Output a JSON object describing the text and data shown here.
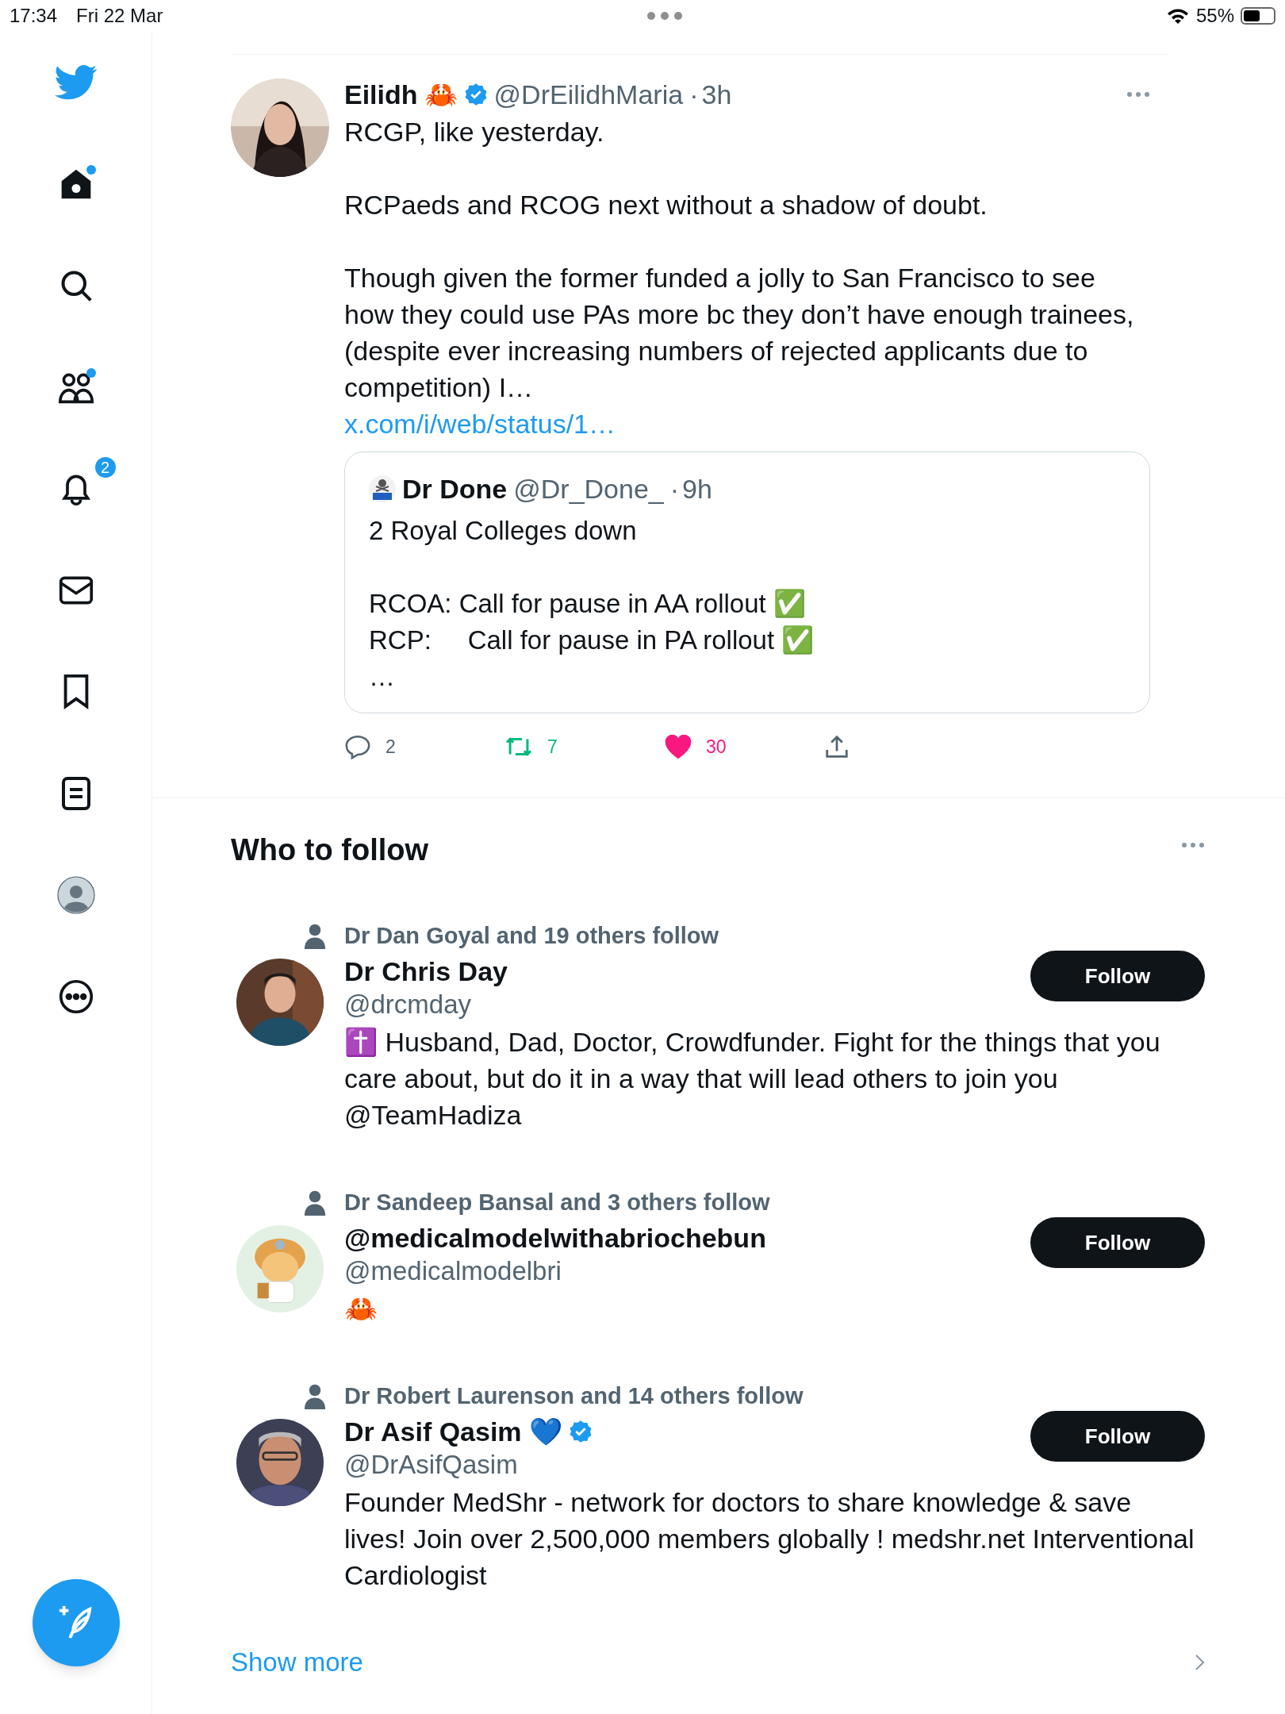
{
  "status_bar": {
    "time": "17:34",
    "date": "Fri 22 Mar",
    "battery": "55%"
  },
  "sidebar": {
    "items": [
      {
        "kind": "logo",
        "dot": false
      },
      {
        "kind": "home",
        "dot": true
      },
      {
        "kind": "search",
        "dot": false
      },
      {
        "kind": "communities",
        "dot": true
      },
      {
        "kind": "notifications",
        "dot": false,
        "badge": "2"
      },
      {
        "kind": "messages",
        "dot": false
      },
      {
        "kind": "bookmarks",
        "dot": false
      },
      {
        "kind": "lists",
        "dot": false
      },
      {
        "kind": "profile",
        "dot": false
      },
      {
        "kind": "more",
        "dot": false
      }
    ]
  },
  "tweet": {
    "author": "Eilidh",
    "author_emoji": "🦀",
    "verified": true,
    "handle": "@DrEilidhMaria",
    "separator": "·",
    "time": "3h",
    "paragraphs": [
      "RCGP, like yesterday.",
      "RCPaeds and RCOG next without a shadow of doubt.",
      "Though given the former funded a jolly to San Francisco to see how they could use PAs more bc they don’t have enough trainees, (despite ever increasing numbers of rejected applicants due to competition) I…"
    ],
    "link": "x.com/i/web/status/1…",
    "quote": {
      "author": "Dr Done",
      "handle": "@Dr_Done_",
      "separator": "·",
      "time": "9h",
      "paragraphs": [
        "2 Royal Colleges down",
        "RCOA: Call for pause in AA rollout ✅\nRCP:     Call for pause in PA rollout ✅\n…"
      ]
    },
    "actions": [
      {
        "kind": "reply",
        "count": "2",
        "on": false
      },
      {
        "kind": "retweet",
        "count": "7",
        "on": true
      },
      {
        "kind": "like",
        "count": "30",
        "on": true
      },
      {
        "kind": "share",
        "on": false
      }
    ]
  },
  "who_to_follow": {
    "title": "Who to follow",
    "suggestions": [
      {
        "context": "Dr Dan Goyal and 19 others follow",
        "name": "Dr Chris Day",
        "verified": false,
        "handle": "@drcmday",
        "bio": "✝️ Husband, Dad, Doctor, Crowdfunder. Fight for the things that you care about, but do it in a way that will lead others to join you @TeamHadiza",
        "button": "Follow"
      },
      {
        "context": "Dr Sandeep Bansal and 3 others follow",
        "name": "@medicalmodelwithabriochebun",
        "verified": false,
        "handle": "@medicalmodelbri",
        "bio": "🦀",
        "button": "Follow"
      },
      {
        "context": "Dr Robert Laurenson and 14 others follow",
        "name": "Dr Asif Qasim 💙",
        "verified": true,
        "handle": "@DrAsifQasim",
        "bio": "Founder MedShr - network for doctors to share knowledge & save lives! Join over 2,500,000 members globally ! medshr.net Interventional Cardiologist",
        "button": "Follow"
      }
    ],
    "show_more": "Show more"
  }
}
